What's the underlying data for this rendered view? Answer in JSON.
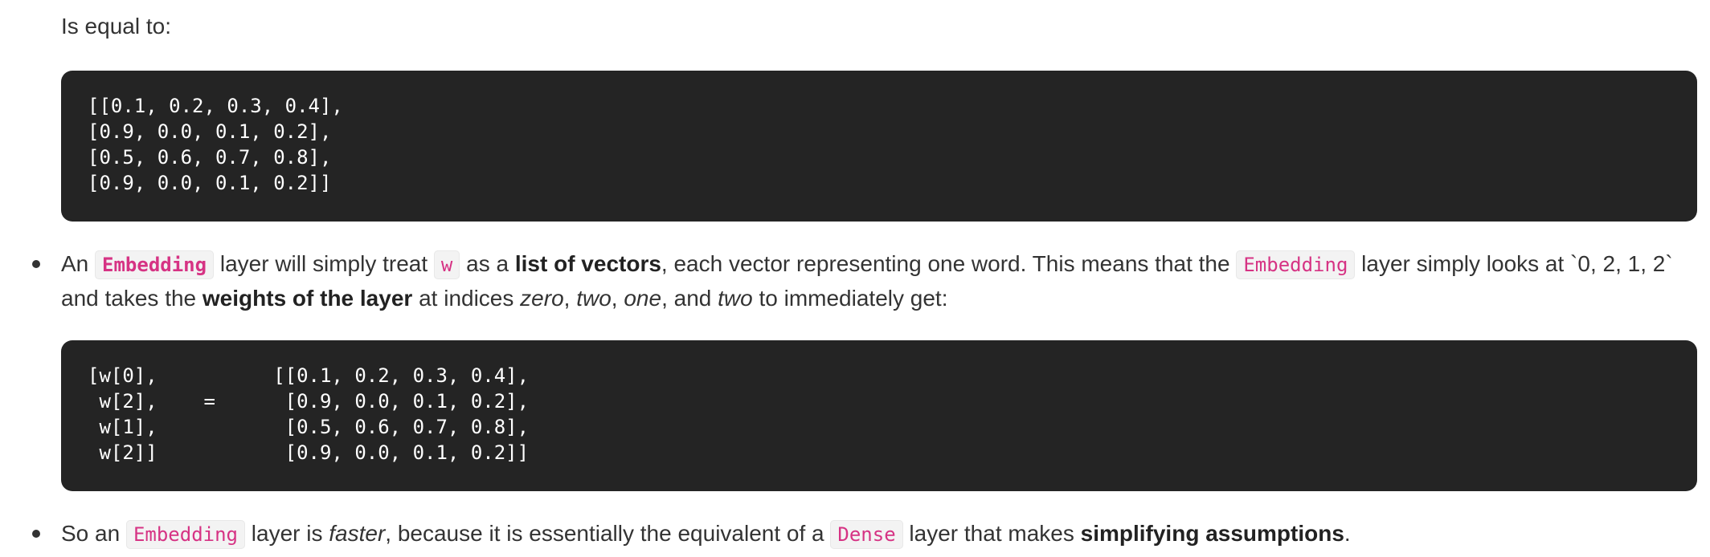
{
  "intro": "Is equal to:",
  "code_block_1": [
    "[[0.1, 0.2, 0.3, 0.4],",
    "[0.9, 0.0, 0.1, 0.2],",
    "[0.5, 0.6, 0.7, 0.8],",
    "[0.9, 0.0, 0.1, 0.2]]"
  ],
  "bullet1": {
    "t1": "An ",
    "c1": "Embedding",
    "t2": " layer will simply treat ",
    "c2": "w",
    "t3": " as a ",
    "b1": "list of vectors",
    "t4": ", each vector representing one word. This means that the ",
    "c3": "Embedding",
    "t5": " layer simply looks at `0, 2, 1, 2`",
    "t6": "and takes the ",
    "b2": "weights of the layer",
    "t7": " at indices ",
    "i1": "zero",
    "t8": ", ",
    "i2": "two",
    "t9": ", ",
    "i3": "one",
    "t10": ", and ",
    "i4": "two",
    "t11": " to immediately get:"
  },
  "code_block_2": [
    "[w[0],          [[0.1, 0.2, 0.3, 0.4],",
    " w[2],    =      [0.9, 0.0, 0.1, 0.2],",
    " w[1],           [0.5, 0.6, 0.7, 0.8],",
    " w[2]]           [0.9, 0.0, 0.1, 0.2]]"
  ],
  "bullet2": {
    "t1": "So an ",
    "c1": "Embedding",
    "t2": " layer is ",
    "i1": "faster",
    "t3": ", because it is essentially the equivalent of a ",
    "c2": "Dense",
    "t4": " layer that makes ",
    "b1": "simplifying assumptions",
    "t5": "."
  }
}
